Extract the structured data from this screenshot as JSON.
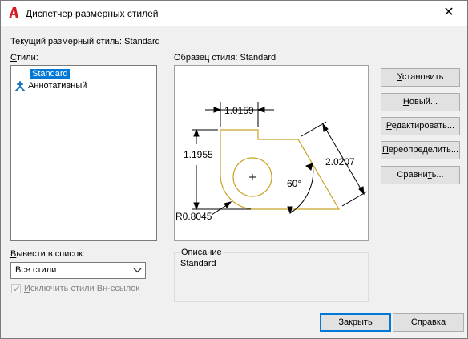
{
  "window": {
    "title": "Диспетчер размерных стилей",
    "close_glyph": "✕"
  },
  "current_style_label": "Текущий размерный стиль: Standard",
  "styles_label_prefix": "С",
  "styles_label_rest": "тили:",
  "styles": [
    {
      "label": "Standard",
      "selected": true
    },
    {
      "label": "Аннотативный",
      "selected": false,
      "icon": "annotative-icon"
    }
  ],
  "preview": {
    "label": "Образец стиля: Standard",
    "dims": {
      "top": "1.0159",
      "left": "1.1955",
      "right": "2.0207",
      "angle": "60°",
      "radius": "R0.8045"
    },
    "colors": {
      "outline": "#c9a227",
      "dimension": "#000000"
    }
  },
  "list_filter": {
    "label_prefix": "В",
    "label_rest": "ывести в список:",
    "value": "Все стили"
  },
  "exclude_xref": {
    "label_prefix": "И",
    "label_rest": "сключить стили Вн-ссылок",
    "checked": true
  },
  "description": {
    "title": "Описание",
    "text": "Standard"
  },
  "buttons": {
    "set_current": {
      "u": "У",
      "rest": "становить"
    },
    "new": {
      "u": "Н",
      "rest": "овый..."
    },
    "modify": {
      "u": "Р",
      "rest": "едактировать..."
    },
    "override": {
      "u": "П",
      "rest": "ереопределить..."
    },
    "compare": {
      "pre": "Сравни",
      "u": "т",
      "rest": "ь..."
    },
    "close": "Закрыть",
    "help": "Справка"
  }
}
